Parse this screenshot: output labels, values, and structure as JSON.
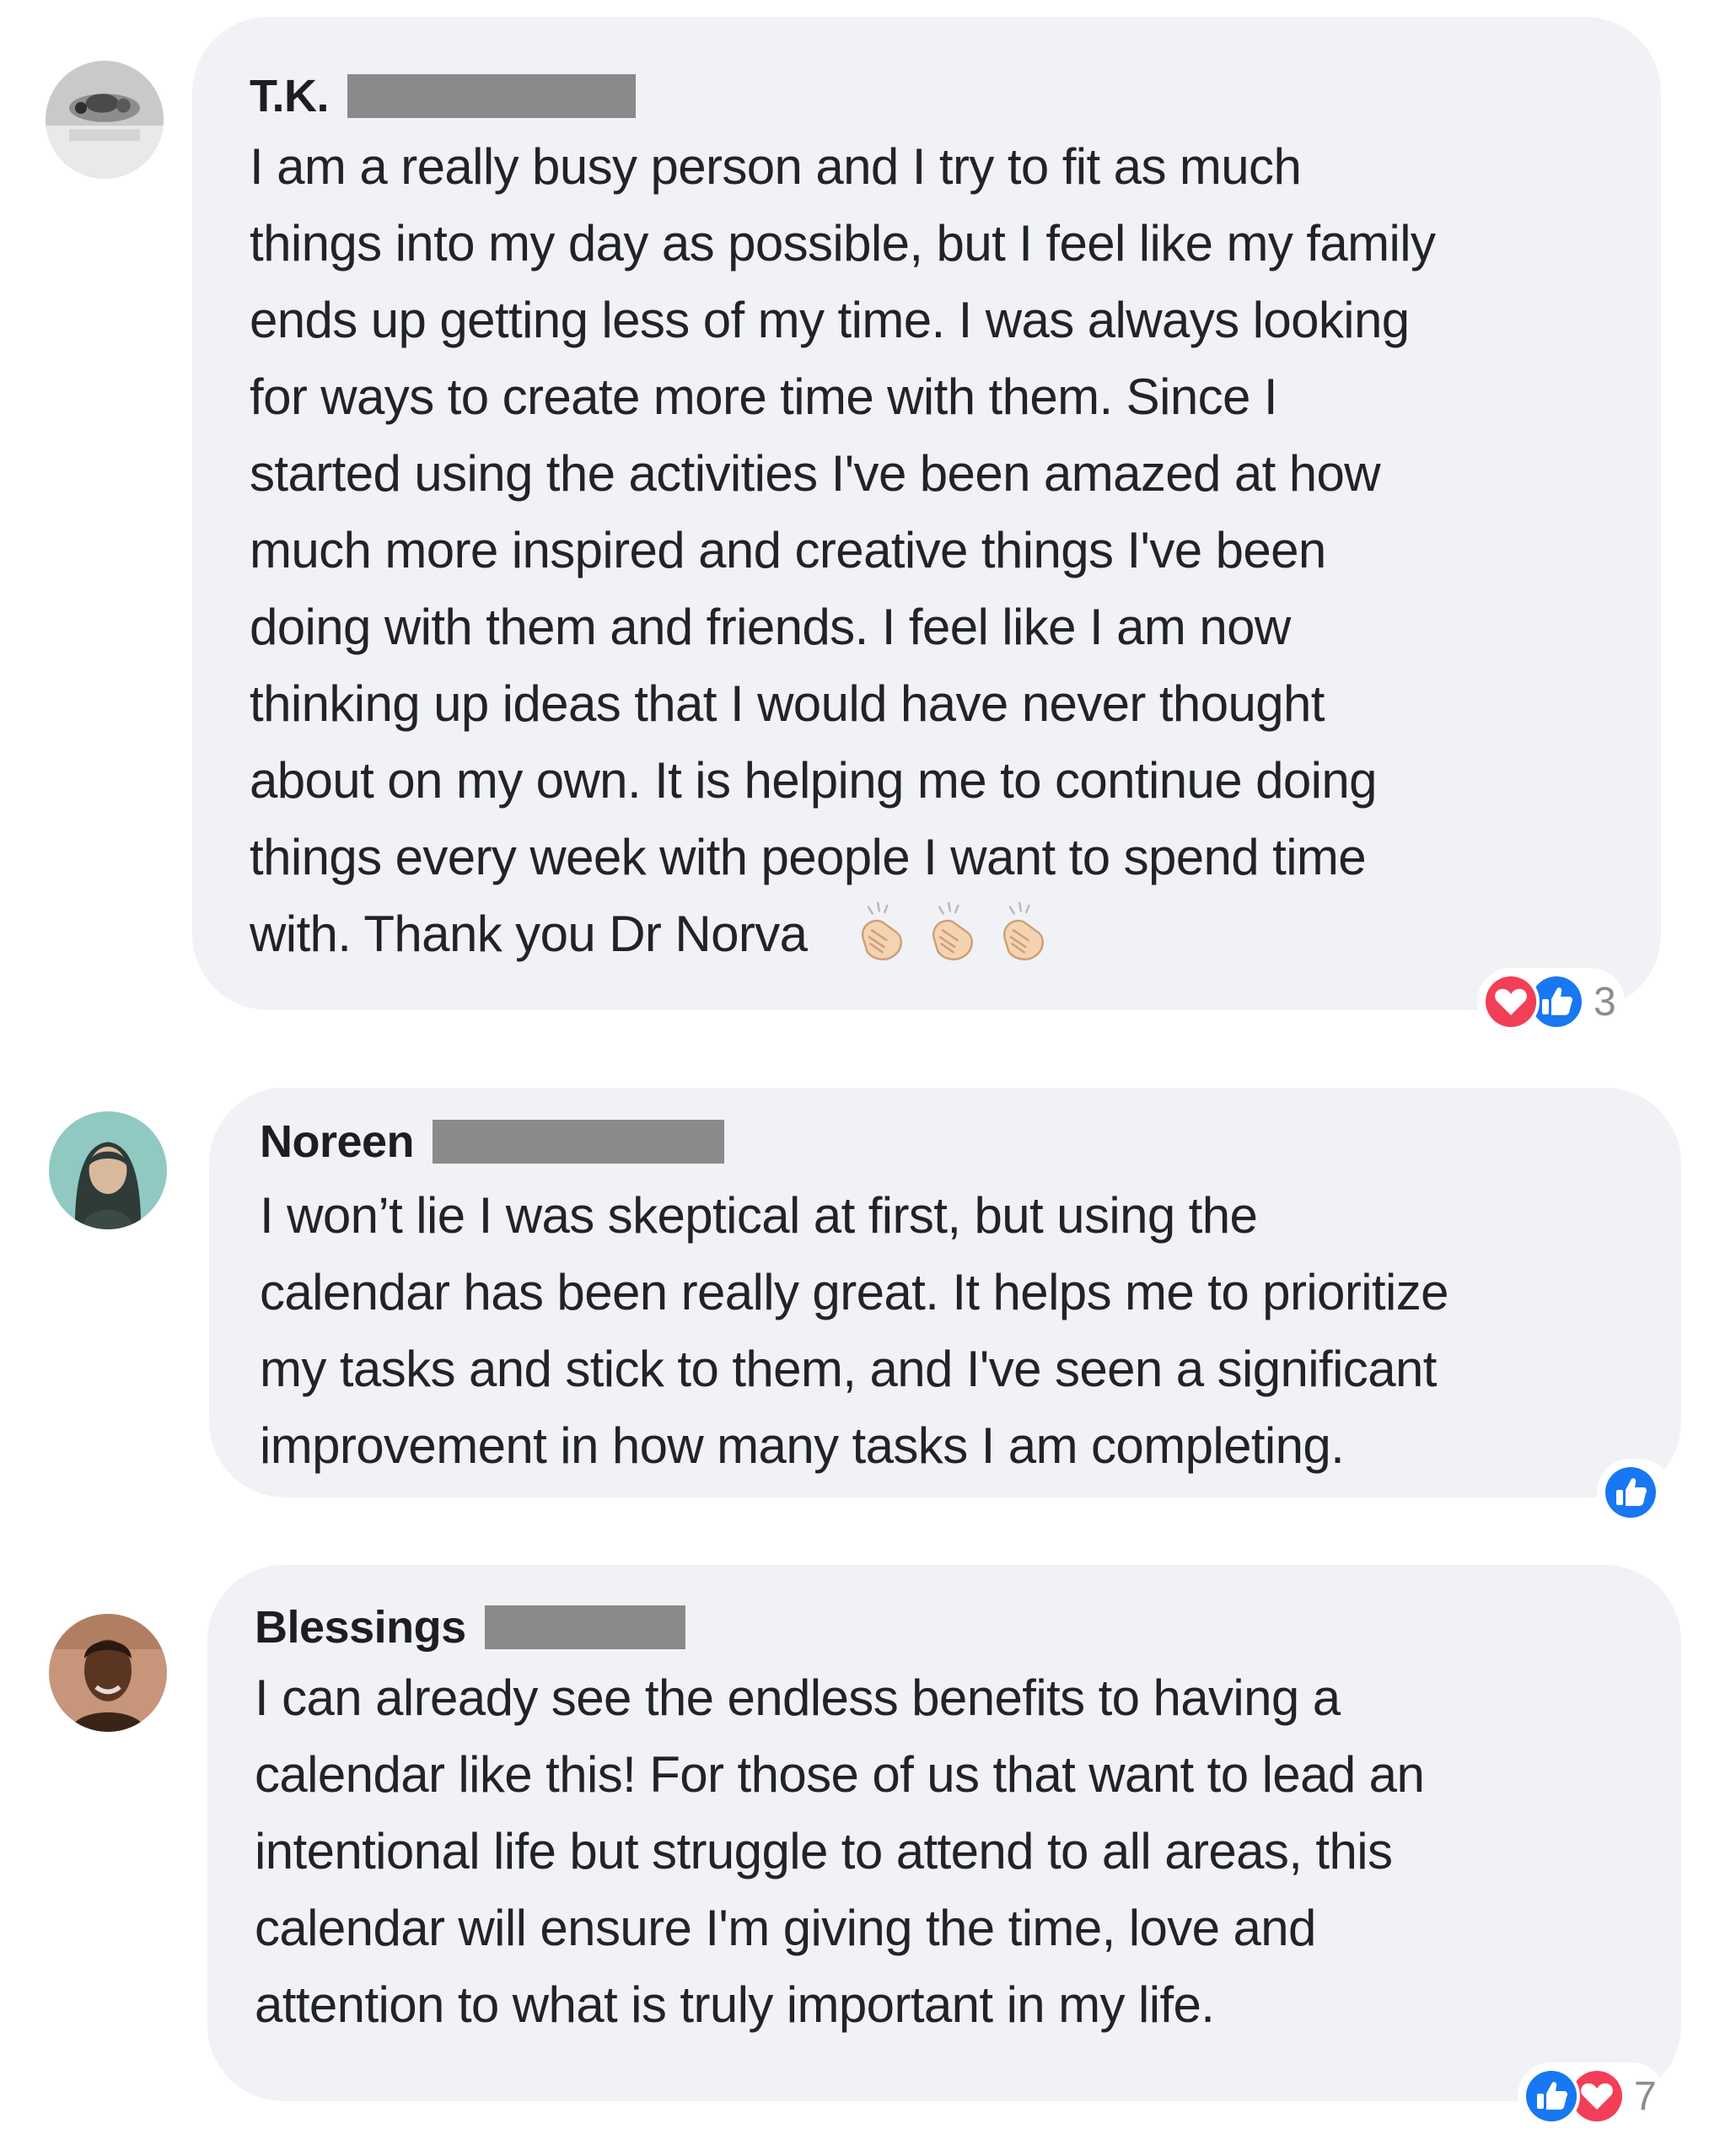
{
  "comments": [
    {
      "author": "T.K.",
      "lines": [
        "I am a really busy person and I try to fit as much",
        "things into my day as possible, but I feel like my family",
        "ends up getting less of my time. I was always looking",
        "for ways to create more time with them. Since I",
        "started using the activities I've been amazed at how",
        "much more inspired and creative things I've been",
        "doing with them and friends. I feel like I am now",
        "thinking up ideas that I would have never thought",
        "about on my own. It is helping me to continue doing",
        "things every week with people I want to spend time",
        "with. Thank you Dr Norva"
      ],
      "emoji": [
        "clapping-hands",
        "clapping-hands",
        "clapping-hands"
      ],
      "reactions": {
        "icons": [
          "love",
          "like"
        ],
        "count": "3"
      }
    },
    {
      "author": "Noreen",
      "lines": [
        "I won’t lie I was skeptical at first, but using the",
        "calendar has been really great. It helps me to prioritize",
        "my tasks and stick to them, and I've seen a significant",
        "improvement in how many tasks I am completing."
      ],
      "reactions": {
        "icons": [
          "like"
        ],
        "count": ""
      }
    },
    {
      "author": "Blessings",
      "lines": [
        "I can already see the endless benefits to having a",
        "calendar like this! For those of us that want to lead an",
        "intentional life but struggle to attend to all areas, this",
        "calendar will ensure I'm giving the time, love and",
        "attention to what is truly important in my life."
      ],
      "reactions": {
        "icons": [
          "like",
          "love"
        ],
        "count": "7"
      }
    }
  ],
  "colors": {
    "bubble": "#f0f2f5",
    "like": "#1877f2",
    "love": "#f33e58",
    "redaction": "#8a8a8a",
    "text": "#222326"
  }
}
